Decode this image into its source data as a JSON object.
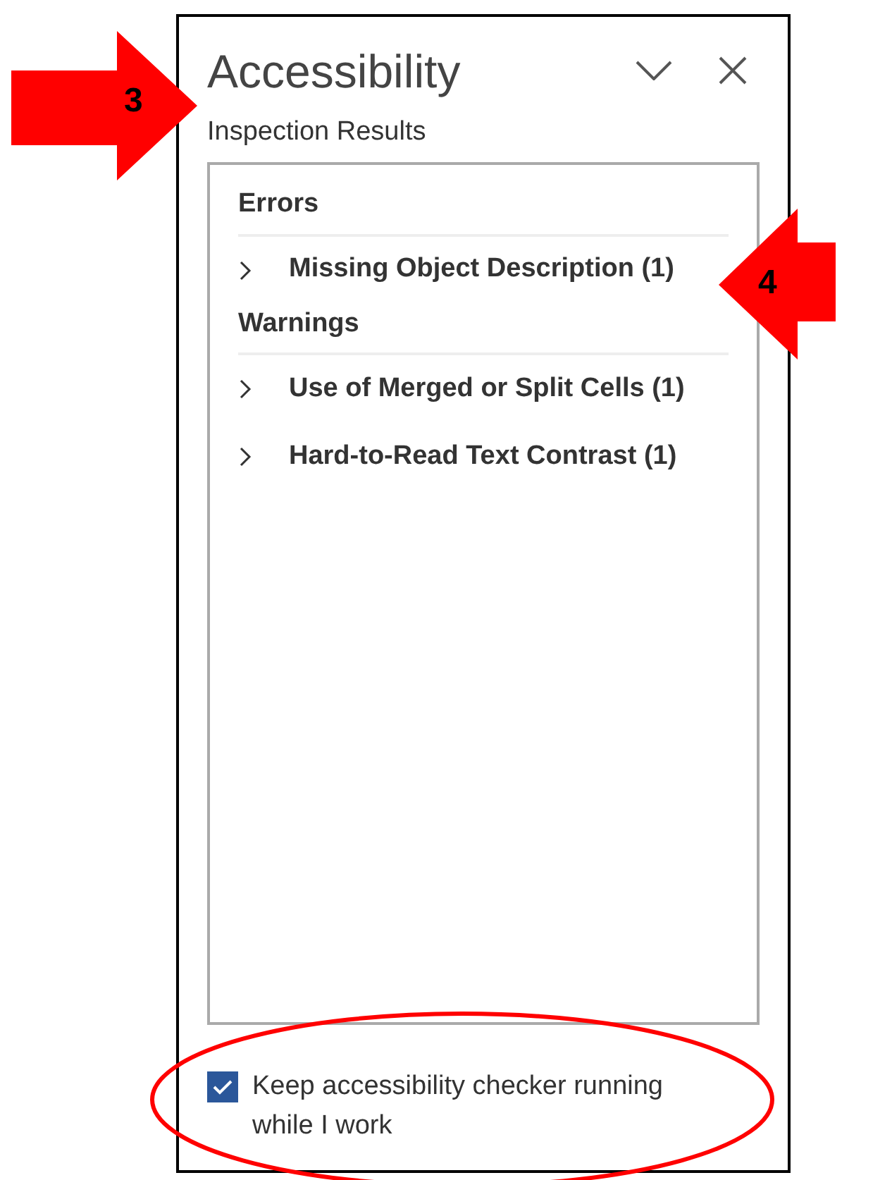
{
  "pane": {
    "title": "Accessibility",
    "subtitle": "Inspection Results",
    "sections": [
      {
        "heading": "Errors",
        "items": [
          {
            "label": "Missing Object Description (1)",
            "expanded": false
          }
        ]
      },
      {
        "heading": "Warnings",
        "items": [
          {
            "label": "Use of Merged or Split Cells (1)",
            "expanded": false
          },
          {
            "label": "Hard-to-Read Text Contrast (1)",
            "expanded": false
          }
        ]
      }
    ],
    "option": {
      "label": "Keep accessibility checker running while I work",
      "checked": true
    }
  },
  "annotations": [
    {
      "kind": "arrow_right",
      "label": "3"
    },
    {
      "kind": "arrow_left",
      "label": "4"
    },
    {
      "kind": "ellipse"
    }
  ]
}
